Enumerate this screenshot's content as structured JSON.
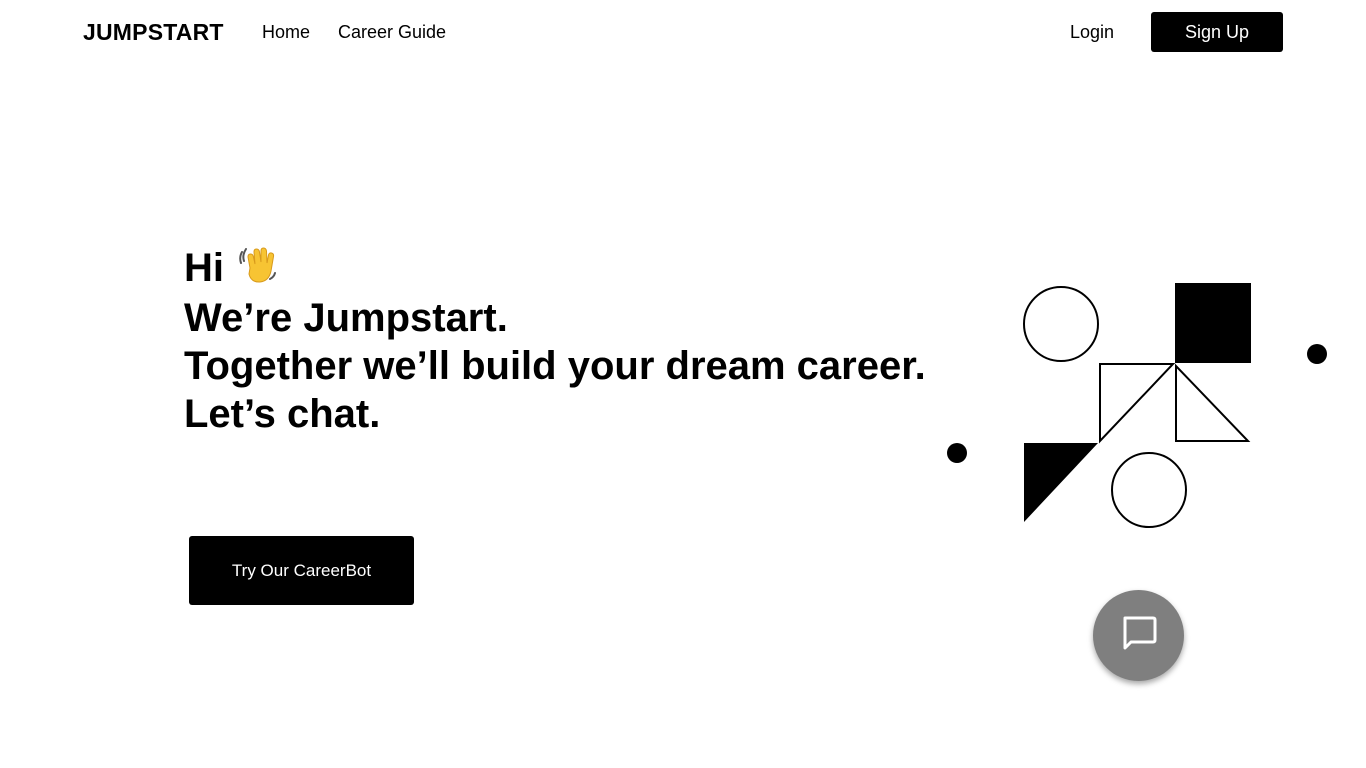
{
  "nav": {
    "brand": "JUMPSTART",
    "links": [
      {
        "label": "Home"
      },
      {
        "label": "Career Guide"
      }
    ],
    "login_label": "Login",
    "signup_label": "Sign Up"
  },
  "hero": {
    "greeting": "Hi",
    "greeting_icon": "waving-hand-icon",
    "lines": [
      "We’re Jumpstart.",
      "Together we’ll build your dream career.",
      "Let’s chat."
    ],
    "cta_label": "Try Our CareerBot"
  },
  "chat_fab": {
    "icon": "chat-bubble-icon",
    "color": "#7f7f7f"
  },
  "colors": {
    "primary": "#000000",
    "background": "#ffffff",
    "wave_hand": "#f7c433"
  }
}
